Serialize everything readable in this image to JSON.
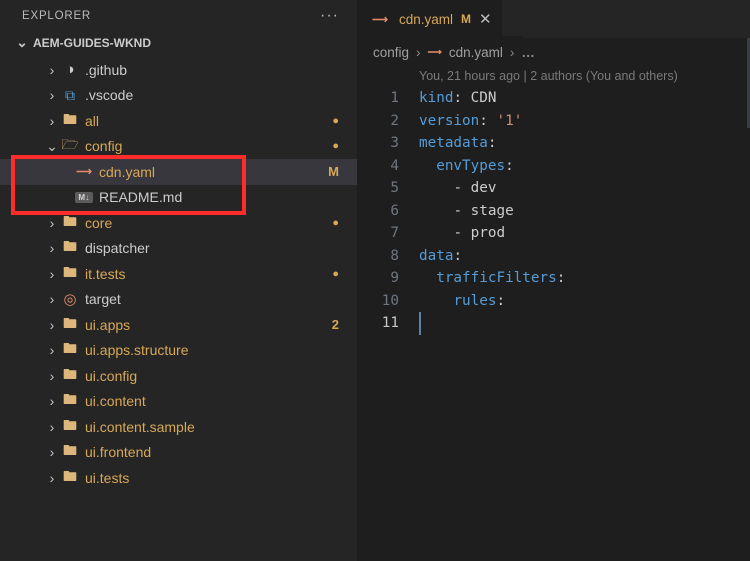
{
  "sidebar": {
    "title": "EXPLORER",
    "workspace": "AEM-GUIDES-WKND",
    "items": [
      {
        "label": ".github",
        "icon": "git",
        "color": "default",
        "suffix": "",
        "depth": 2,
        "open": false,
        "chev": true
      },
      {
        "label": ".vscode",
        "icon": "vsc",
        "color": "default",
        "suffix": "",
        "depth": 2,
        "open": false,
        "chev": true
      },
      {
        "label": "all",
        "icon": "folder",
        "color": "amber",
        "suffix": "dot",
        "depth": 2,
        "open": false,
        "chev": true
      },
      {
        "label": "config",
        "icon": "folder-open",
        "color": "amber",
        "suffix": "dot",
        "depth": 2,
        "open": true,
        "chev": true,
        "selectedHighlight": true
      },
      {
        "label": "cdn.yaml",
        "icon": "yaml",
        "color": "amber",
        "suffix": "M",
        "depth": 3,
        "open": false,
        "chev": false,
        "selected": true
      },
      {
        "label": "README.md",
        "icon": "md",
        "color": "default",
        "suffix": "",
        "depth": 3,
        "open": false,
        "chev": false
      },
      {
        "label": "core",
        "icon": "folder",
        "color": "amber",
        "suffix": "dot",
        "depth": 2,
        "open": false,
        "chev": true
      },
      {
        "label": "dispatcher",
        "icon": "folder",
        "color": "default",
        "suffix": "",
        "depth": 2,
        "open": false,
        "chev": true
      },
      {
        "label": "it.tests",
        "icon": "folder",
        "color": "amber",
        "suffix": "dot",
        "depth": 2,
        "open": false,
        "chev": true
      },
      {
        "label": "target",
        "icon": "target",
        "color": "default",
        "suffix": "",
        "depth": 2,
        "open": false,
        "chev": true
      },
      {
        "label": "ui.apps",
        "icon": "folder",
        "color": "amber",
        "suffix": "2",
        "depth": 2,
        "open": false,
        "chev": true
      },
      {
        "label": "ui.apps.structure",
        "icon": "folder",
        "color": "amber",
        "suffix": "",
        "depth": 2,
        "open": false,
        "chev": true
      },
      {
        "label": "ui.config",
        "icon": "folder",
        "color": "amber",
        "suffix": "",
        "depth": 2,
        "open": false,
        "chev": true
      },
      {
        "label": "ui.content",
        "icon": "folder",
        "color": "amber",
        "suffix": "",
        "depth": 2,
        "open": false,
        "chev": true
      },
      {
        "label": "ui.content.sample",
        "icon": "folder",
        "color": "amber",
        "suffix": "",
        "depth": 2,
        "open": false,
        "chev": true
      },
      {
        "label": "ui.frontend",
        "icon": "folder",
        "color": "amber",
        "suffix": "",
        "depth": 2,
        "open": false,
        "chev": true
      },
      {
        "label": "ui.tests",
        "icon": "folder",
        "color": "amber",
        "suffix": "",
        "depth": 2,
        "open": false,
        "chev": true
      }
    ]
  },
  "tab": {
    "filename": "cdn.yaml",
    "modified_flag": "M"
  },
  "breadcrumb": {
    "seg1": "config",
    "seg2": "cdn.yaml"
  },
  "blame": "You, 21 hours ago | 2 authors (You and others)",
  "code": {
    "lines": {
      "l1": {
        "key": "kind",
        "colon": ": ",
        "val": "CDN"
      },
      "l2": {
        "key": "version",
        "colon": ": ",
        "val": "'1'"
      },
      "l3": {
        "key": "metadata",
        "colon": ":"
      },
      "l4": {
        "indent": "  ",
        "key": "envTypes",
        "colon": ":"
      },
      "l5": {
        "indent": "    ",
        "dash": "- ",
        "val": "dev"
      },
      "l6": {
        "indent": "    ",
        "dash": "- ",
        "val": "stage"
      },
      "l7": {
        "indent": "    ",
        "dash": "- ",
        "val": "prod"
      },
      "l8": {
        "key": "data",
        "colon": ":"
      },
      "l9": {
        "indent": "  ",
        "key": "trafficFilters",
        "colon": ":"
      },
      "l10": {
        "indent": "    ",
        "key": "rules",
        "colon": ":"
      }
    }
  },
  "line_numbers": {
    "n1": "1",
    "n2": "2",
    "n3": "3",
    "n4": "4",
    "n5": "5",
    "n6": "6",
    "n7": "7",
    "n8": "8",
    "n9": "9",
    "n10": "10",
    "n11": "11"
  }
}
